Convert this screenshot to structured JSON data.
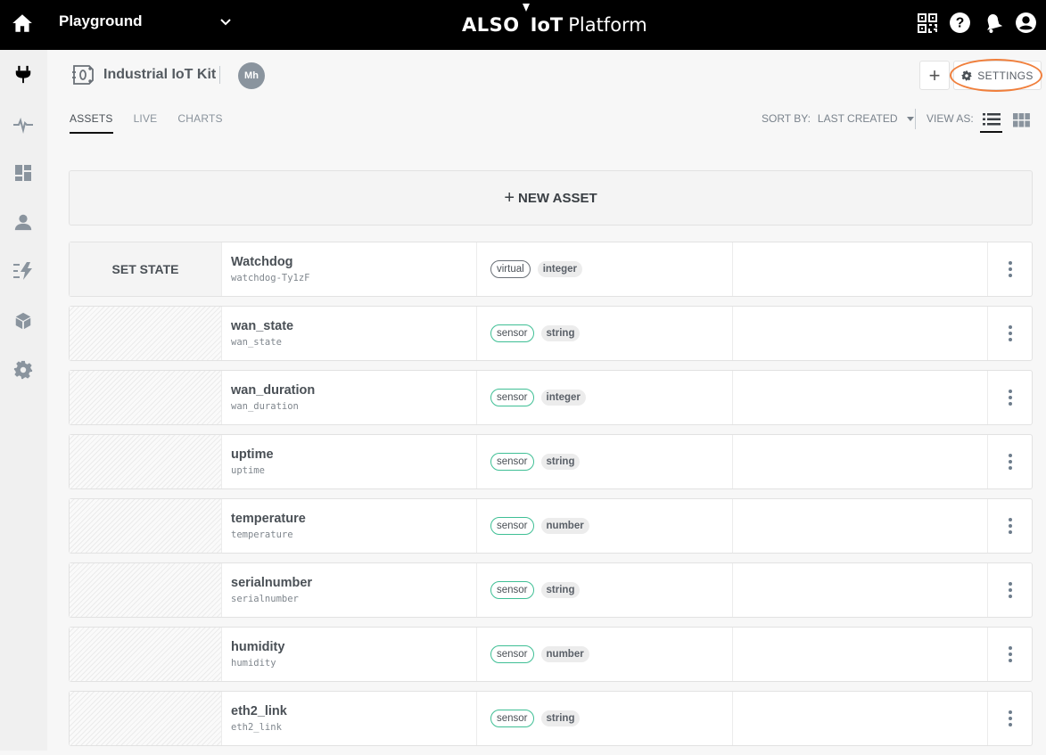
{
  "topbar": {
    "project_name": "Playground",
    "brand": {
      "also": "ALSO",
      "iot": "IoT",
      "platform": "Platform"
    },
    "icons": [
      "qr-code-icon",
      "help-icon",
      "notifications-bell-icon",
      "account-icon"
    ]
  },
  "sidebar": {
    "items": [
      {
        "name": "devices",
        "icon": "plug-icon",
        "active": true
      },
      {
        "name": "activity",
        "icon": "pulse-icon",
        "active": false
      },
      {
        "name": "dashboards",
        "icon": "dashboard-icon",
        "active": false
      },
      {
        "name": "users",
        "icon": "user-icon",
        "active": false
      },
      {
        "name": "rules",
        "icon": "automation-icon",
        "active": false
      },
      {
        "name": "things",
        "icon": "cube-icon",
        "active": false
      },
      {
        "name": "settings",
        "icon": "gear-icon",
        "active": false
      }
    ]
  },
  "header": {
    "device_name": "Industrial IoT Kit",
    "avatar_initials": "Mh",
    "add_label": "+",
    "settings_label": "SETTINGS"
  },
  "tabs": [
    {
      "label": "ASSETS",
      "active": true
    },
    {
      "label": "LIVE",
      "active": false
    },
    {
      "label": "CHARTS",
      "active": false
    }
  ],
  "sort": {
    "label": "SORT BY:",
    "value": "LAST CREATED"
  },
  "view": {
    "label": "VIEW AS:",
    "selected": "list"
  },
  "new_asset": {
    "plus": "+",
    "label": "NEW ASSET"
  },
  "assets": [
    {
      "control": "SET STATE",
      "title": "Watchdog",
      "id": "watchdog-Ty1zF",
      "kind": "virtual",
      "type": "integer"
    },
    {
      "control": "",
      "title": "wan_state",
      "id": "wan_state",
      "kind": "sensor",
      "type": "string"
    },
    {
      "control": "",
      "title": "wan_duration",
      "id": "wan_duration",
      "kind": "sensor",
      "type": "integer"
    },
    {
      "control": "",
      "title": "uptime",
      "id": "uptime",
      "kind": "sensor",
      "type": "string"
    },
    {
      "control": "",
      "title": "temperature",
      "id": "temperature",
      "kind": "sensor",
      "type": "number"
    },
    {
      "control": "",
      "title": "serialnumber",
      "id": "serialnumber",
      "kind": "sensor",
      "type": "string"
    },
    {
      "control": "",
      "title": "humidity",
      "id": "humidity",
      "kind": "sensor",
      "type": "number"
    },
    {
      "control": "",
      "title": "eth2_link",
      "id": "eth2_link",
      "kind": "sensor",
      "type": "string"
    }
  ],
  "colors": {
    "topbar_bg": "#000000",
    "sensor_tag_border": "#3fbf95",
    "settings_highlight": "#f07f3c"
  }
}
